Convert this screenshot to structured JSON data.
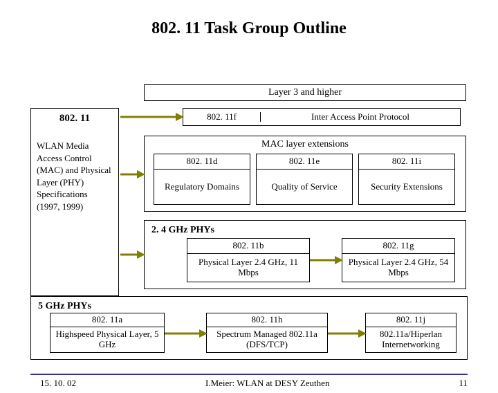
{
  "title": "802. 11 Task Group Outline",
  "sidebar": {
    "standard": "802. 11",
    "desc": "WLAN Media Access Control (MAC) and Physical Layer (PHY) Specifications (1997, 1999)"
  },
  "layer3": "Layer 3 and higher",
  "iapp": {
    "std": "802. 11f",
    "desc": "Inter Access Point Protocol"
  },
  "mac": {
    "title": "MAC layer extensions",
    "d": {
      "std": "802. 11d",
      "desc": "Regulatory Domains"
    },
    "e": {
      "std": "802. 11e",
      "desc": "Quality of Service"
    },
    "i": {
      "std": "802. 11i",
      "desc": "Security Extensions"
    }
  },
  "phy24": {
    "title": "2. 4 GHz PHYs",
    "b": {
      "std": "802. 11b",
      "desc": "Physical Layer 2.4 GHz, 11 Mbps"
    },
    "g": {
      "std": "802. 11g",
      "desc": "Physical Layer 2.4 GHz, 54 Mbps"
    }
  },
  "phy5": {
    "title": "5 GHz PHYs",
    "a": {
      "std": "802. 11a",
      "desc": "Highspeed Physical Layer, 5 GHz"
    },
    "h": {
      "std": "802. 11h",
      "desc": "Spectrum Managed 802.11a (DFS/TCP)"
    },
    "j": {
      "std": "802. 11j",
      "desc": "802.11a/Hiperlan Internetworking"
    }
  },
  "footer": {
    "date": "15. 10. 02",
    "center": "I.Meier: WLAN at DESY Zeuthen",
    "page": "11"
  }
}
